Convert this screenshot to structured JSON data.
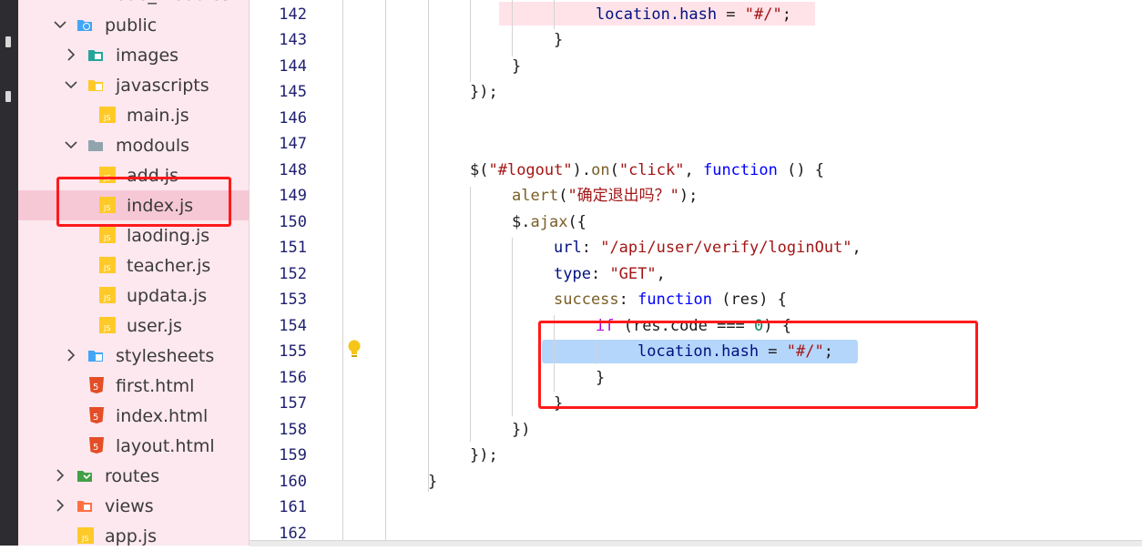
{
  "sidebar": {
    "top_partial": "node_modules",
    "items": [
      {
        "label": "public",
        "kind": "folder-web",
        "expanded": true
      },
      {
        "label": "images",
        "kind": "folder-images",
        "expanded": false
      },
      {
        "label": "javascripts",
        "kind": "folder-js",
        "expanded": true
      },
      {
        "label": "main.js",
        "kind": "js"
      },
      {
        "label": "modouls",
        "kind": "folder",
        "expanded": true
      },
      {
        "label": "add.js",
        "kind": "js"
      },
      {
        "label": "index.js",
        "kind": "js",
        "selected": true
      },
      {
        "label": "laoding.js",
        "kind": "js"
      },
      {
        "label": "teacher.js",
        "kind": "js"
      },
      {
        "label": "updata.js",
        "kind": "js"
      },
      {
        "label": "user.js",
        "kind": "js"
      },
      {
        "label": "stylesheets",
        "kind": "folder-css",
        "expanded": false
      },
      {
        "label": "first.html",
        "kind": "html"
      },
      {
        "label": "index.html",
        "kind": "html"
      },
      {
        "label": "layout.html",
        "kind": "html"
      },
      {
        "label": "routes",
        "kind": "folder-routes",
        "expanded": false
      },
      {
        "label": "views",
        "kind": "folder-views",
        "expanded": false
      },
      {
        "label": "app.js",
        "kind": "js"
      }
    ],
    "js_badge": "JS",
    "html_badge": "5"
  },
  "editor": {
    "line_numbers": [
      "142",
      "143",
      "144",
      "145",
      "146",
      "147",
      "148",
      "149",
      "150",
      "151",
      "152",
      "153",
      "154",
      "155",
      "156",
      "157",
      "158",
      "159",
      "160",
      "161",
      "162"
    ],
    "code": {
      "l142": {
        "a": "location.hash",
        "b": " = ",
        "c": "\"#/\"",
        "d": ";"
      },
      "l143": "}",
      "l144": "}",
      "l145": "});",
      "l148": {
        "a": "$(",
        "b": "\"#logout\"",
        "c": ").",
        "d": "on",
        "e": "(",
        "f": "\"click\"",
        "g": ", ",
        "h": "function",
        "i": " () {"
      },
      "l149": {
        "a": "alert",
        "b": "(",
        "c": "\"确定退出吗？\"",
        "d": ");"
      },
      "l150": {
        "a": "$.",
        "b": "ajax",
        "c": "({"
      },
      "l151": {
        "a": "url",
        "b": ": ",
        "c": "\"/api/user/verify/loginOut\"",
        "d": ","
      },
      "l152": {
        "a": "type",
        "b": ": ",
        "c": "\"GET\"",
        "d": ","
      },
      "l153": {
        "a": "success",
        "b": ": ",
        "c": "function",
        "d": " (res) {"
      },
      "l154": {
        "a": "if",
        "b": " (res.code ",
        "c": "===",
        "d": " ",
        "e": "0",
        "f": ") {"
      },
      "l155": {
        "a": "location.hash",
        "b": " = ",
        "c": "\"#/\"",
        "d": ";"
      },
      "l156": "}",
      "l157": "}",
      "l158": "})",
      "l159": "});",
      "l160": "}"
    }
  },
  "colors": {
    "sidebar_bg": "#fce8ee",
    "selection": "#f6c8d6",
    "annotation": "#ff1a1a",
    "highlight": "#b5d6fb"
  }
}
